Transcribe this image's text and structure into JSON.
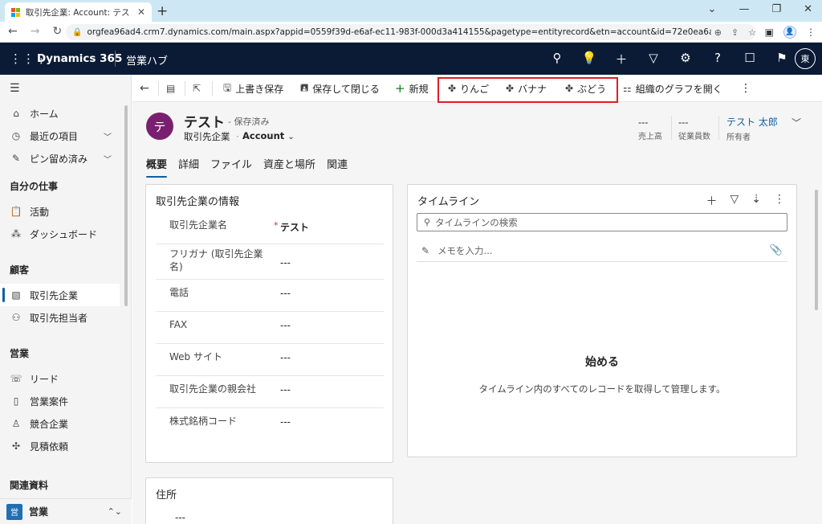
{
  "browser": {
    "tab_title": "取引先企業: Account: テスト - Dynamics 365",
    "tab_close": "✕",
    "new_tab": "+",
    "url": "orgfea96ad4.crm7.dynamics.com/main.aspx?appid=0559f39d-e6af-ec11-983f-000d3a414155&pagetype=entityrecord&etn=account&id=72e0ea6a-18d8-ec11-a7...",
    "profile_initial": "👤"
  },
  "header": {
    "brand": "Dynamics 365",
    "app_name": "営業ハブ",
    "user_initial": "東"
  },
  "sidebar": {
    "home": "ホーム",
    "recent": "最近の項目",
    "pinned": "ピン留め済み",
    "section_my_work": "自分の仕事",
    "activities": "活動",
    "dashboards": "ダッシュボード",
    "section_customers": "顧客",
    "accounts": "取引先企業",
    "contacts": "取引先担当者",
    "section_sales": "営業",
    "leads": "リード",
    "opportunities": "営業案件",
    "competitors": "競合企業",
    "quotes": "見積依頼",
    "section_related": "関連資料",
    "area_badge": "営",
    "area_name": "営業"
  },
  "commandbar": {
    "save": "上書き保存",
    "save_close": "保存して閉じる",
    "new": "新規",
    "apple": "りんご",
    "banana": "バナナ",
    "grape": "ぶどう",
    "org_chart": "組織のグラフを開く",
    "more": "⋮"
  },
  "record": {
    "avatar_initial": "テ",
    "title": "テスト",
    "saved_status": "- 保存済み",
    "entity": "取引先企業",
    "separator": "·",
    "form_name": "Account",
    "revenue_value": "---",
    "revenue_label": "売上高",
    "employees_value": "---",
    "employees_label": "従業員数",
    "owner_name": "テスト 太郎",
    "owner_label": "所有者"
  },
  "tabs": [
    "概要",
    "詳細",
    "ファイル",
    "資産と場所",
    "関連"
  ],
  "account_info": {
    "title": "取引先企業の情報",
    "fields": [
      {
        "label": "取引先企業名",
        "required": "*",
        "value": "テスト"
      },
      {
        "label": "フリガナ (取引先企業名)",
        "value": "---"
      },
      {
        "label": "電話",
        "value": "---"
      },
      {
        "label": "FAX",
        "value": "---"
      },
      {
        "label": "Web サイト",
        "value": "---"
      },
      {
        "label": "取引先企業の親会社",
        "value": "---"
      },
      {
        "label": "株式銘柄コード",
        "value": "---"
      }
    ]
  },
  "address": {
    "title": "住所",
    "value": "---"
  },
  "timeline": {
    "title": "タイムライン",
    "search_placeholder": "タイムラインの検索",
    "memo_placeholder": "メモを入力...",
    "empty_title": "始める",
    "empty_desc": "タイムライン内のすべてのレコードを取得して管理します。"
  }
}
